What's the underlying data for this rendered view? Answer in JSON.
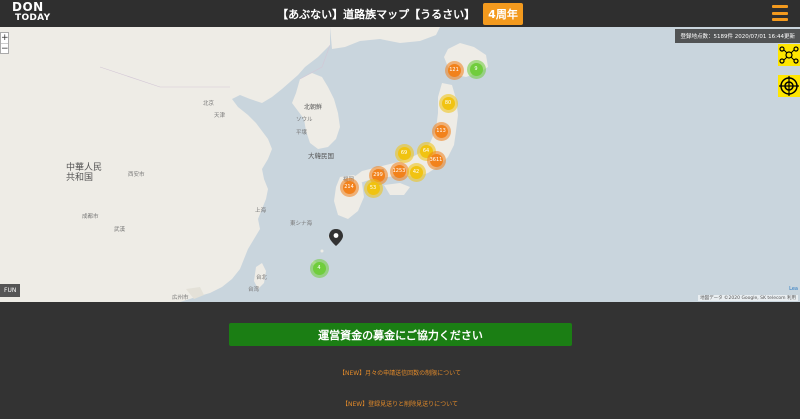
{
  "header": {
    "logo_line1": "DON",
    "logo_line2": "TODAY",
    "title": "【あぶない】道路族マップ【うるさい】",
    "anniversary_badge": "4周年",
    "accent_color": "#f39a1e"
  },
  "map": {
    "zoom_in": "+",
    "zoom_out": "−",
    "registration_info": "登録地点数：5189件 2020/07/01 16:44更新",
    "fun_label": "FUN",
    "leaflet_label": "Lea",
    "copyright": "地図データ ©2020 Google, SK telecom    利用",
    "labels": {
      "china": "中華人民\n共和国",
      "korea": "大韓民国",
      "north_korea": "北朝鮮",
      "beijing": "北京",
      "shanghai": "上海",
      "chengdu": "成都市",
      "xian": "西安市",
      "wuhan": "武漢",
      "taiwan": "台湾",
      "guangzhou": "広州市",
      "taipei": "台北",
      "tianjin": "天津",
      "seoul": "ソウル",
      "pyongyang": "平壌",
      "east_china_sea": "東シナ海",
      "hiroshima": "広島",
      "fukuoka": "福岡"
    },
    "clusters": [
      {
        "count": "121",
        "color": "orange"
      },
      {
        "count": "9",
        "color": "green"
      },
      {
        "count": "80",
        "color": "yellow"
      },
      {
        "count": "113",
        "color": "orange"
      },
      {
        "count": "69",
        "color": "yellow"
      },
      {
        "count": "64",
        "color": "yellow"
      },
      {
        "count": "3611",
        "color": "orange"
      },
      {
        "count": "1253",
        "color": "orange"
      },
      {
        "count": "299",
        "color": "orange"
      },
      {
        "count": "42",
        "color": "yellow"
      },
      {
        "count": "214",
        "color": "orange"
      },
      {
        "count": "53",
        "color": "yellow"
      },
      {
        "count": "4",
        "color": "green"
      }
    ]
  },
  "bottom": {
    "donate_label": "運営資金の募金にご協力ください",
    "news1": "【NEW】月々の申請送信回数の制限について",
    "news2": "【NEW】登録見送りと削除見送りについて"
  }
}
